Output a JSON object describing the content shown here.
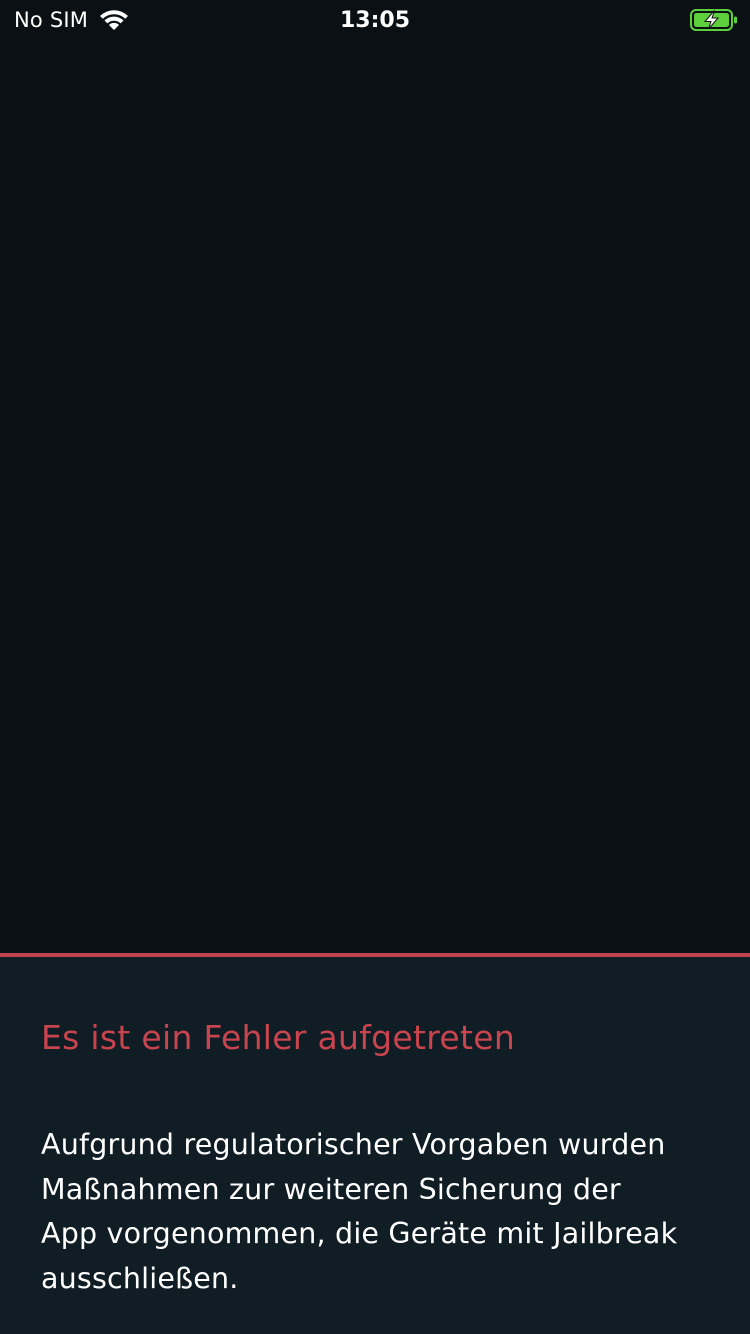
{
  "status_bar": {
    "carrier": "No SIM",
    "time": "13:05",
    "wifi_icon": "wifi-icon",
    "battery_icon": "battery-charging-icon",
    "battery_color": "#5ccf3c"
  },
  "error": {
    "title": "Es ist ein Fehler aufgetreten",
    "message": "Aufgrund regulatorischer Vorgaben wurden Maßnahmen zur weiteren Sicherung der App vorgenommen, die Geräte mit Jailbreak ausschließen.",
    "accent_color": "#c8444e"
  },
  "colors": {
    "background": "#0a1014",
    "panel": "#111d24"
  }
}
